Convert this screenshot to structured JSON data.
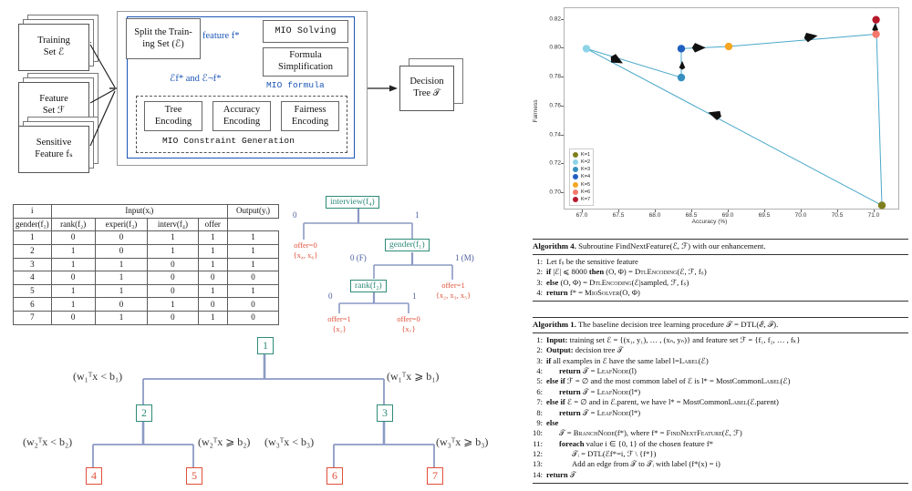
{
  "flowchart": {
    "inputs": [
      {
        "line1": "Training",
        "line2": "Set ℰ"
      },
      {
        "line1": "Feature",
        "line2": "Set ℱ"
      },
      {
        "line1": "Sensitive",
        "line2": "Feature fₛ"
      }
    ],
    "split_box": "Split the Train-\ning Set (ℰ)",
    "split_box_l1": "Split the Train-",
    "split_box_l2": "ing Set (ℰ)",
    "mio_solving": "MIO Solving",
    "formula_simpl_l1": "Formula",
    "formula_simpl_l2": "Simplification",
    "encodings": [
      {
        "l1": "Tree",
        "l2": "Encoding"
      },
      {
        "l1": "Accuracy",
        "l2": "Encoding"
      },
      {
        "l1": "Fairness",
        "l2": "Encoding"
      }
    ],
    "constraint_gen_label": "MIO Constraint Generation",
    "label_feature": "feature f*",
    "label_split_out": "ℰf*  and  ℰ¬f*",
    "label_mio_formula": "MIO formula",
    "output_l1": "Decision",
    "output_l2": "Tree 𝒯"
  },
  "table": {
    "col_i": "i",
    "group_input": "Input(xᵢ)",
    "group_output": "Output(yᵢ)",
    "headers": [
      "gender(f₁)",
      "rank(f₂)",
      "experi(f₃)",
      "interv(f₄)"
    ],
    "output_header": "offer",
    "rows": [
      {
        "i": "1",
        "cells": [
          "0",
          "0",
          "1",
          "1"
        ],
        "out": "1"
      },
      {
        "i": "2",
        "cells": [
          "1",
          "0",
          "1",
          "1"
        ],
        "out": "1"
      },
      {
        "i": "3",
        "cells": [
          "1",
          "1",
          "0",
          "1"
        ],
        "out": "1"
      },
      {
        "i": "4",
        "cells": [
          "0",
          "1",
          "0",
          "0"
        ],
        "out": "0"
      },
      {
        "i": "5",
        "cells": [
          "1",
          "1",
          "0",
          "1"
        ],
        "out": "1"
      },
      {
        "i": "6",
        "cells": [
          "1",
          "0",
          "1",
          "0"
        ],
        "out": "0"
      },
      {
        "i": "7",
        "cells": [
          "0",
          "1",
          "0",
          "1"
        ],
        "out": "0"
      }
    ]
  },
  "dtree": {
    "root": "interview(f₄)",
    "node_gender": "gender(f₁)",
    "node_rank": "rank(f₂)",
    "edge_root_left": "0",
    "edge_root_right": "1",
    "edge_gender_left": "0 (F)",
    "edge_gender_right": "1 (M)",
    "edge_rank_left": "0",
    "edge_rank_right": "1",
    "leaf_a_l1": "offer=0",
    "leaf_a_l2": "{x₄, x₆}",
    "leaf_b_l1": "offer=1",
    "leaf_b_l2": "{x₂, x₃, x₅}",
    "leaf_c_l1": "offer=1",
    "leaf_c_l2": "{x₁}",
    "leaf_d_l1": "offer=0",
    "leaf_d_l2": "{x₇}"
  },
  "btree": {
    "nodes": [
      "1",
      "2",
      "3"
    ],
    "leaves": [
      "4",
      "5",
      "6",
      "7"
    ],
    "labels": {
      "l1": "(w₁ᵀx < b₁)",
      "r1": "(w₁ᵀx ⩾ b₁)",
      "l2": "(w₂ᵀx < b₂)",
      "r2": "(w₂ᵀx ⩾ b₂)",
      "l3": "(w₃ᵀx < b₃)",
      "r3": "(w₃ᵀx ⩾ b₃)"
    }
  },
  "chart_data": {
    "type": "scatter",
    "title": "",
    "xlabel": "Accuracy (%)",
    "ylabel": "Fairness",
    "xlim": [
      66.75,
      71.35
    ],
    "ylim": [
      0.688,
      0.828
    ],
    "xticks": [
      "67.0",
      "67.5",
      "68.0",
      "68.5",
      "69.0",
      "69.5",
      "70.0",
      "70.5",
      "71.0"
    ],
    "xtick_values": [
      67.0,
      67.5,
      68.0,
      68.5,
      69.0,
      69.5,
      70.0,
      70.5,
      71.0
    ],
    "yticks": [
      "0.70",
      "0.72",
      "0.74",
      "0.76",
      "0.78",
      "0.80",
      "0.82"
    ],
    "ytick_values": [
      0.7,
      0.72,
      0.74,
      0.76,
      0.78,
      0.8,
      0.82
    ],
    "grid": false,
    "legend_position": "lower-left",
    "line_color": "#4aa8c9",
    "points": [
      {
        "label": "K=1",
        "x": 71.1,
        "y": 0.6915,
        "color": "#7f7f1e"
      },
      {
        "label": "K=2",
        "x": 67.05,
        "y": 0.8,
        "color": "#8dd3e8"
      },
      {
        "label": "K=3",
        "x": 68.35,
        "y": 0.78,
        "color": "#3690c0"
      },
      {
        "label": "K=4",
        "x": 68.35,
        "y": 0.8,
        "color": "#1f5fbf"
      },
      {
        "label": "K=5",
        "x": 69.0,
        "y": 0.8015,
        "color": "#f5a623"
      },
      {
        "label": "K=6",
        "x": 71.02,
        "y": 0.81,
        "color": "#f4796b"
      },
      {
        "label": "K=7",
        "x": 71.02,
        "y": 0.82,
        "color": "#b5182b"
      }
    ],
    "path_order": [
      "K=2",
      "K=3",
      "K=4",
      "K=5",
      "K=6",
      "K=7",
      "K=1"
    ],
    "legend": [
      {
        "label": "K=1",
        "color": "#7f7f1e"
      },
      {
        "label": "K=2",
        "color": "#8dd3e8"
      },
      {
        "label": "K=3",
        "color": "#3690c0"
      },
      {
        "label": "K=4",
        "color": "#1f5fbf"
      },
      {
        "label": "K=5",
        "color": "#f5a623"
      },
      {
        "label": "K=6",
        "color": "#f4796b"
      },
      {
        "label": "K=7",
        "color": "#b5182b"
      }
    ]
  },
  "algorithm4": {
    "title_bold": "Algorithm 4.",
    "title_rest": "Subroutine FindNextFeature(ℰ, ℱ) with our enhancement.",
    "lines": [
      {
        "n": "1:",
        "text": "Let fₛ be the sensitive feature"
      },
      {
        "n": "2:",
        "text": "if |ℰ| ⩽ 8000 then (O, Φ) = DtlEncoding(ℰ, ℱ, fₛ)"
      },
      {
        "n": "3:",
        "text": "else (O, Φ) = DtlEncoding(ℰ|sampled, ℱ, fₛ)"
      },
      {
        "n": "4:",
        "text": "return f* = MioSolver(O, Φ)"
      }
    ]
  },
  "algorithm1": {
    "title_bold": "Algorithm 1.",
    "title_rest": "The baseline decision tree learning procedure 𝒯 = DTL(ℰ, ℱ).",
    "lines": [
      {
        "n": "1:",
        "indent": 0,
        "text": "Input: training set ℰ = {(x₁, y₁), … , (xₙ, yₙ)} and feature set ℱ = {f₁, f₂, … , fₖ}"
      },
      {
        "n": "2:",
        "indent": 0,
        "text": "Output: decision tree 𝒯"
      },
      {
        "n": "3:",
        "indent": 0,
        "text": "if all examples in ℰ have the same label l=Label(ℰ)"
      },
      {
        "n": "4:",
        "indent": 1,
        "text": "return 𝒯 = LeafNode(l)"
      },
      {
        "n": "5:",
        "indent": 0,
        "text": "else if ℱ = ∅ and the most common label of ℰ is l* = MostCommonLabel(ℰ)"
      },
      {
        "n": "6:",
        "indent": 1,
        "text": "return 𝒯 = LeafNode(l*)"
      },
      {
        "n": "7:",
        "indent": 0,
        "text": "else if ℰ = ∅ and in ℰ.parent, we have l* = MostCommonLabel(ℰ.parent)"
      },
      {
        "n": "8:",
        "indent": 1,
        "text": "return 𝒯 = LeafNode(l*)"
      },
      {
        "n": "9:",
        "indent": 0,
        "text": "else"
      },
      {
        "n": "10:",
        "indent": 1,
        "text": "𝒯 = BranchNode(f*), where f* = FindNextFeature(ℰ, ℱ)"
      },
      {
        "n": "11:",
        "indent": 1,
        "text": "foreach value i ∈ {0, 1} of the chosen feature f*"
      },
      {
        "n": "12:",
        "indent": 2,
        "text": "𝒯ᵢ = DTL(ℰf*=i, ℱ \\ {f*})"
      },
      {
        "n": "13:",
        "indent": 2,
        "text": "Add an edge from 𝒯 to 𝒯ᵢ with label (f*(x) = i)"
      },
      {
        "n": "14:",
        "indent": 0,
        "text": "return 𝒯"
      }
    ]
  }
}
